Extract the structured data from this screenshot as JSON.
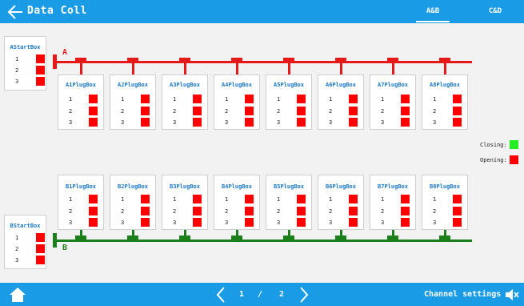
{
  "header": {
    "title": "Data Coll",
    "tabs": [
      {
        "label": "A&B"
      },
      {
        "label": "C&D"
      }
    ]
  },
  "start_boxes": [
    {
      "name": "AStartBox",
      "channels": [
        "1",
        "2",
        "3"
      ],
      "states": [
        "opening",
        "opening",
        "opening"
      ]
    },
    {
      "name": "BStartBox",
      "channels": [
        "1",
        "2",
        "3"
      ],
      "states": [
        "opening",
        "opening",
        "opening"
      ]
    }
  ],
  "bus_labels": {
    "a": "A",
    "b": "B"
  },
  "plug_boxes_a": [
    {
      "name": "A1PlugBox"
    },
    {
      "name": "A2PlugBox"
    },
    {
      "name": "A3PlugBox"
    },
    {
      "name": "A4PlugBox"
    },
    {
      "name": "A5PlugBox"
    },
    {
      "name": "A6PlugBox"
    },
    {
      "name": "A7PlugBox"
    },
    {
      "name": "A8PlugBox"
    }
  ],
  "plug_boxes_b": [
    {
      "name": "B1PlugBox"
    },
    {
      "name": "B2PlugBox"
    },
    {
      "name": "B3PlugBox"
    },
    {
      "name": "B4PlugBox"
    },
    {
      "name": "B5PlugBox"
    },
    {
      "name": "B6PlugBox"
    },
    {
      "name": "B7PlugBox"
    },
    {
      "name": "B8PlugBox"
    }
  ],
  "channels": [
    "1",
    "2",
    "3"
  ],
  "legend": {
    "closing": {
      "label": "Closing:",
      "color": "#22ee22"
    },
    "opening": {
      "label": "Opening:",
      "color": "#ff0000"
    }
  },
  "colors": {
    "bus_a": "#e61919",
    "bus_b": "#1b7f1b",
    "accent": "#1a9be6"
  },
  "footer": {
    "page_current": "1",
    "page_sep": "/",
    "page_total": "2",
    "channel_settings": "Channel settings"
  }
}
